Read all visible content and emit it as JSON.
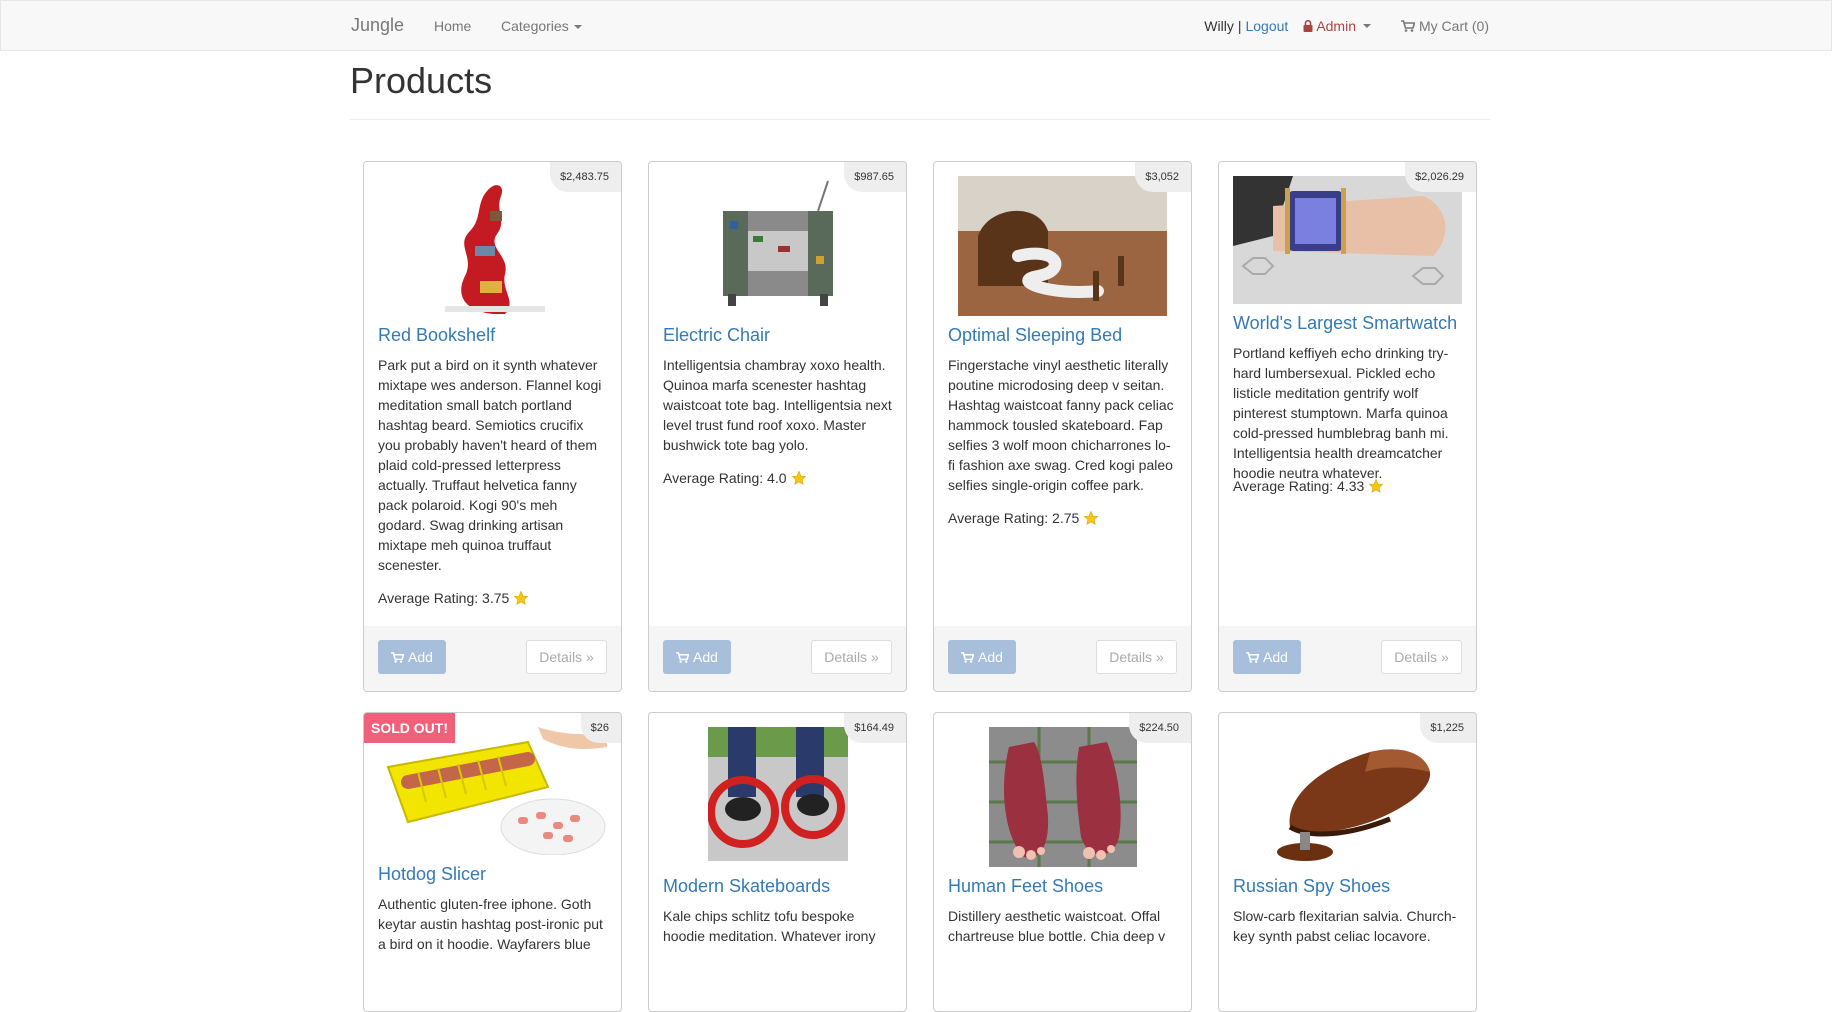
{
  "nav": {
    "brand": "Jungle",
    "home": "Home",
    "categories": "Categories",
    "user": "Willy",
    "separator": "|",
    "logout": "Logout",
    "admin": "Admin",
    "cart": "My Cart (0)"
  },
  "page_title": "Products",
  "buttons": {
    "add": "Add",
    "details": "Details »"
  },
  "rating_prefix": "Average Rating:",
  "colors": {
    "link": "#337ab7",
    "admin": "#a94442",
    "sold_out": "#f0607a",
    "add_button": "#a8bfdc"
  },
  "products": [
    {
      "name": "Red Bookshelf",
      "price": "$2,483.75",
      "description": "Park put a bird on it synth whatever mixtape wes anderson. Flannel kogi meditation small batch portland hashtag beard. Semiotics crucifix you probably haven't heard of them plaid cold-pressed letterpress actually. Truffaut helvetica fanny pack polaroid. Kogi 90's meh godard. Swag drinking artisan mixtape meh quinoa truffaut scenester.",
      "rating": "Average Rating: 3.75"
    },
    {
      "name": "Electric Chair",
      "price": "$987.65",
      "description": "Intelligentsia chambray xoxo health. Quinoa marfa scenester hashtag waistcoat tote bag. Intelligentsia next level trust fund roof xoxo. Master bushwick tote bag yolo.",
      "rating": "Average Rating: 4.0"
    },
    {
      "name": "Optimal Sleeping Bed",
      "price": "$3,052",
      "description": "Fingerstache vinyl aesthetic literally poutine microdosing deep v seitan. Hashtag waistcoat fanny pack celiac hammock tousled skateboard. Fap selfies 3 wolf moon chicharrones lo-fi fashion axe swag. Cred kogi paleo selfies single-origin coffee park.",
      "rating": "Average Rating: 2.75"
    },
    {
      "name": "World's Largest Smartwatch",
      "price": "$2,026.29",
      "description": "Portland keffiyeh echo drinking try-hard lumbersexual. Pickled echo listicle meditation gentrify wolf pinterest stumptown. Marfa quinoa cold-pressed humblebrag banh mi. Intelligentsia health dreamcatcher hoodie neutra whatever.",
      "rating": "Average Rating: 4.33"
    },
    {
      "name": "Hotdog Slicer",
      "price": "$26",
      "badge": "SOLD OUT!",
      "description": "Authentic gluten-free iphone. Goth keytar austin hashtag post-ironic put a bird on it hoodie. Wayfarers blue"
    },
    {
      "name": "Modern Skateboards",
      "price": "$164.49",
      "description": "Kale chips schlitz tofu bespoke hoodie meditation. Whatever irony"
    },
    {
      "name": "Human Feet Shoes",
      "price": "$224.50",
      "description": "Distillery aesthetic waistcoat. Offal chartreuse blue bottle. Chia deep v"
    },
    {
      "name": "Russian Spy Shoes",
      "price": "$1,225",
      "description": "Slow-carb flexitarian salvia. Church-key synth pabst celiac locavore."
    }
  ]
}
